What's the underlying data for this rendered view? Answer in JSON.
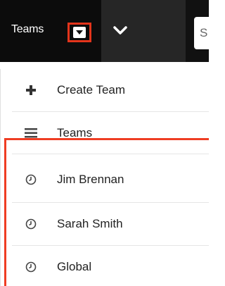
{
  "navbar": {
    "module_label": "Teams",
    "search_stub_text": "S"
  },
  "menu": {
    "actions": [
      {
        "label": "Create Team",
        "icon": "plus-icon"
      },
      {
        "label": "Teams",
        "icon": "list-icon"
      }
    ],
    "recent": [
      {
        "label": "Jim Brennan",
        "icon": "clock-icon"
      },
      {
        "label": "Sarah Smith",
        "icon": "clock-icon"
      },
      {
        "label": "Global",
        "icon": "clock-icon"
      }
    ]
  },
  "colors": {
    "navbar_bg": "#111111",
    "highlight_border": "#ef3d23",
    "text": "#222222"
  }
}
